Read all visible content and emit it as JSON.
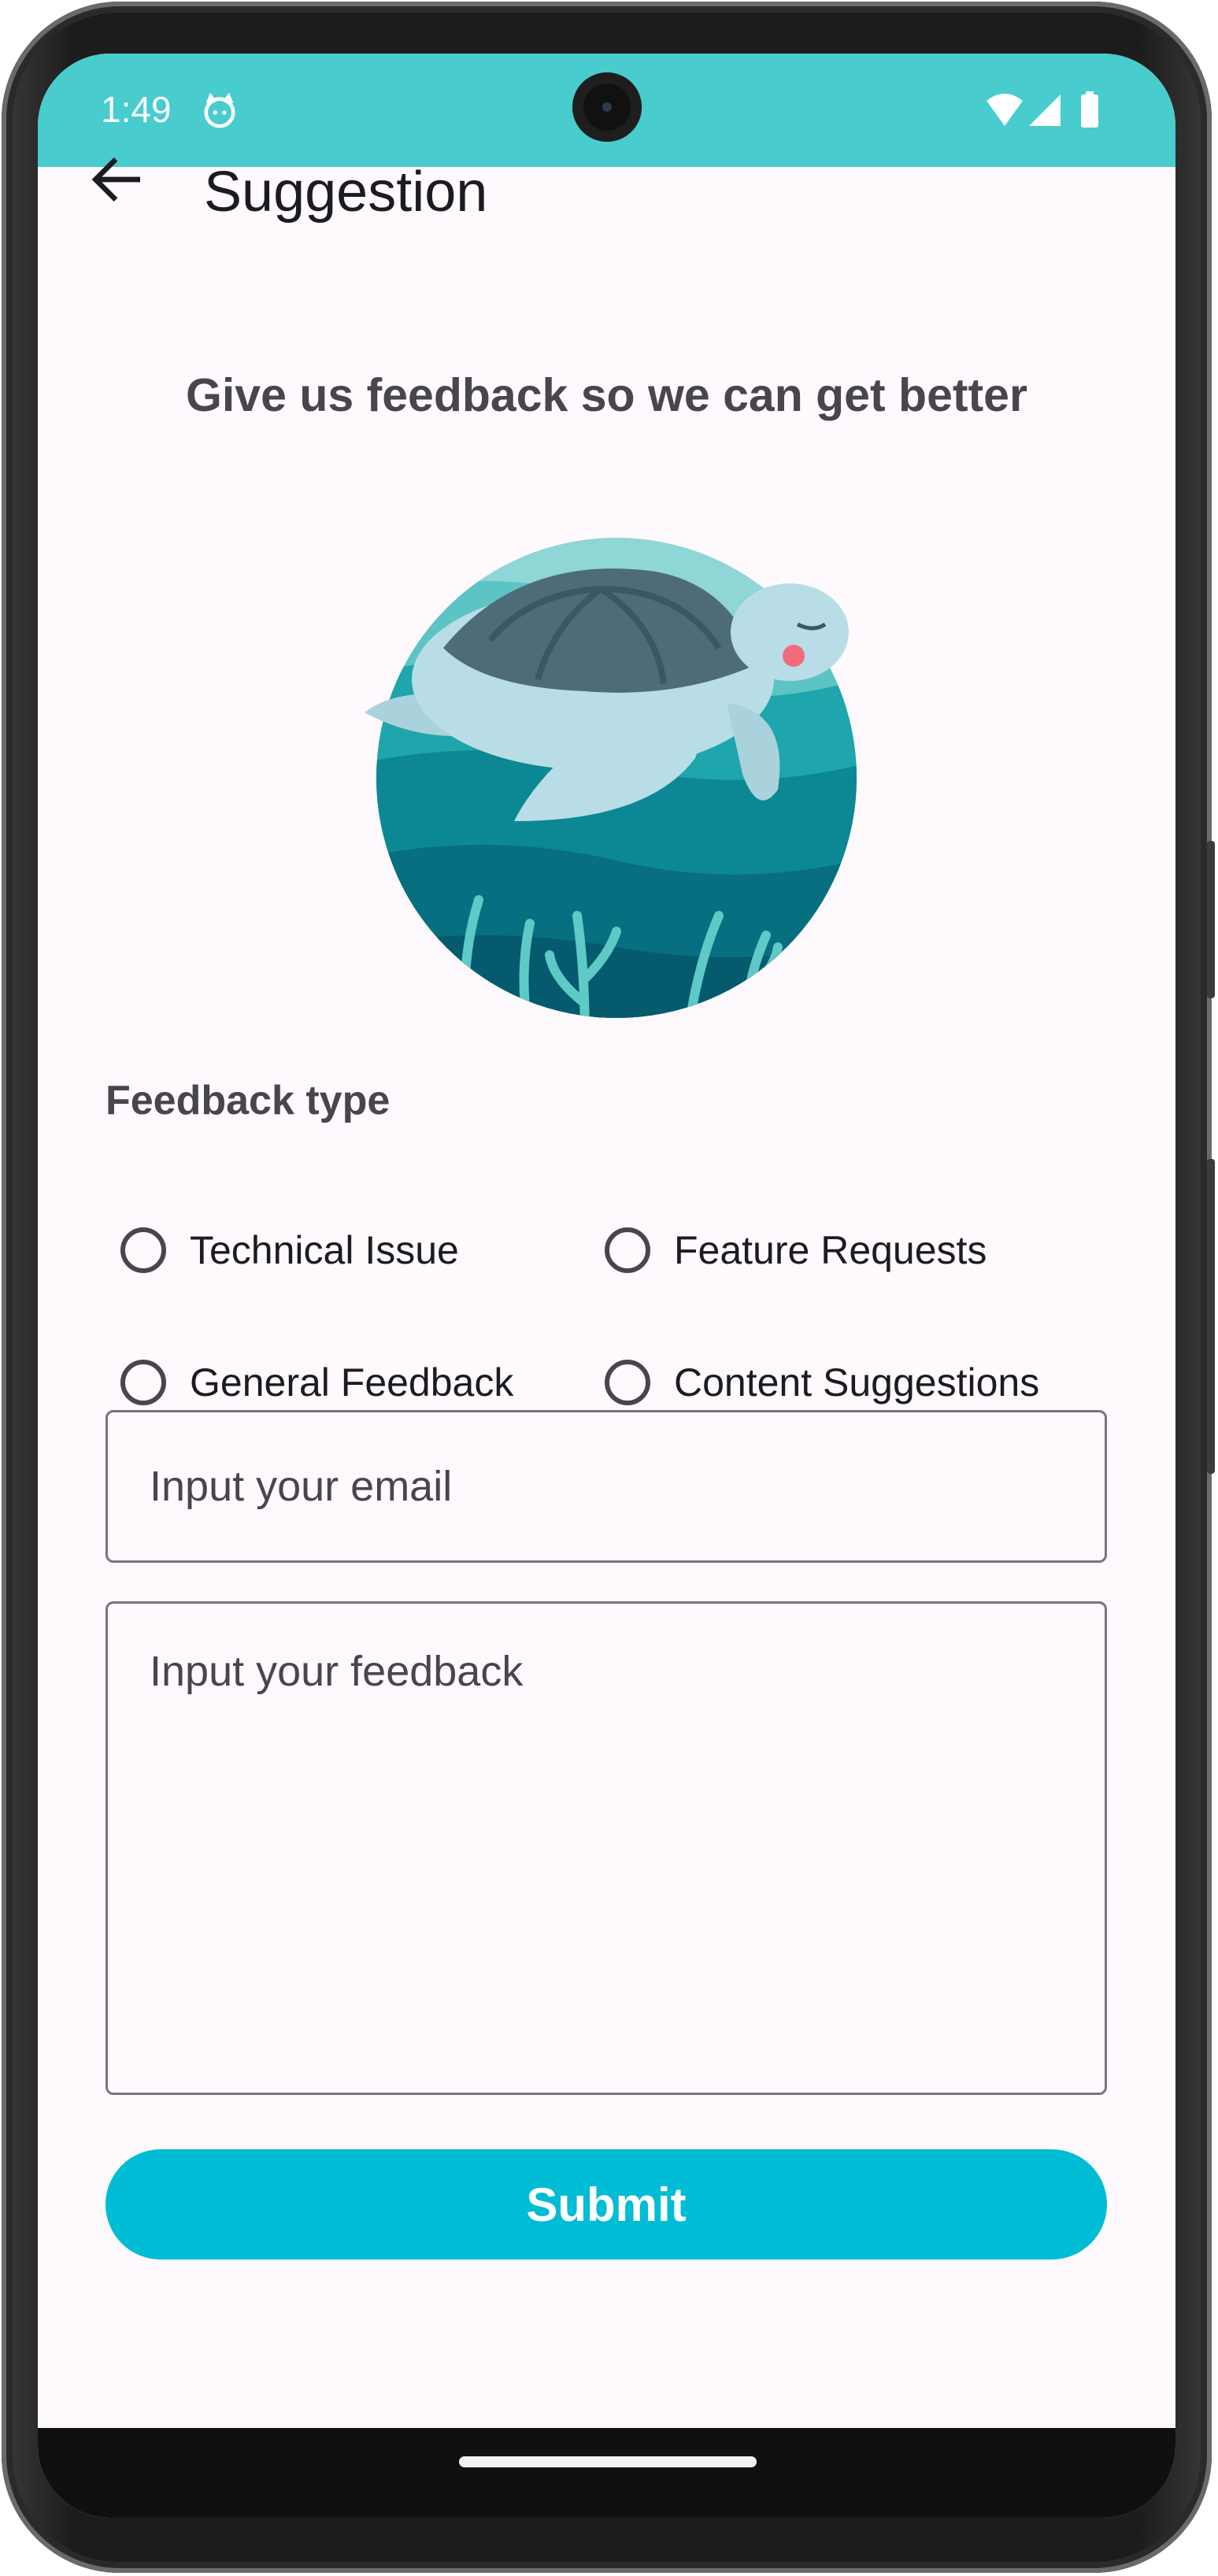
{
  "status_bar": {
    "time": "1:49",
    "background": "#48ccce"
  },
  "app_bar": {
    "title": "Suggestion"
  },
  "headline": "Give us feedback so we can get better",
  "feedback_type": {
    "label": "Feedback type",
    "options": [
      "Technical Issue",
      "Feature Requests",
      "General Feedback",
      "Content Suggestions"
    ]
  },
  "email": {
    "placeholder": "Input your email"
  },
  "feedback": {
    "placeholder": "Input your feedback"
  },
  "submit": {
    "label": "Submit",
    "color": "#00bcd4"
  }
}
